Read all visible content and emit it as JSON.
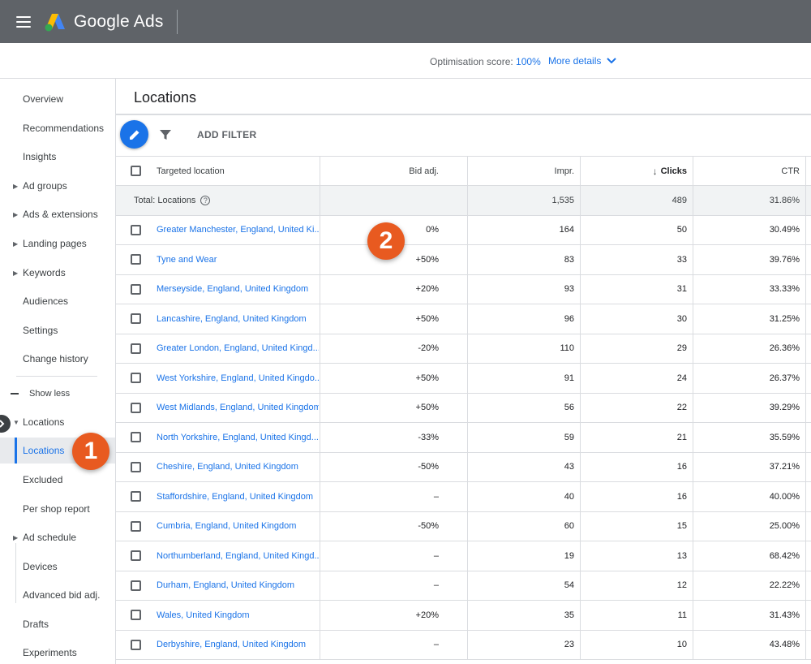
{
  "app": {
    "name": "Google Ads"
  },
  "colors": {
    "topbar": "#5f6368",
    "accent": "#1a73e8",
    "badge": "#e85a20"
  },
  "score": {
    "label": "Optimisation score:",
    "value": "100%",
    "more": "More details"
  },
  "sidebar": {
    "items": [
      {
        "label": "Overview"
      },
      {
        "label": "Recommendations"
      },
      {
        "label": "Insights"
      },
      {
        "label": "Ad groups"
      },
      {
        "label": "Ads & extensions"
      },
      {
        "label": "Landing pages"
      },
      {
        "label": "Keywords"
      },
      {
        "label": "Audiences"
      },
      {
        "label": "Settings"
      },
      {
        "label": "Change history"
      }
    ],
    "show_less": "Show less",
    "locations_group": "Locations",
    "sub_items": [
      {
        "label": "Locations"
      },
      {
        "label": "Excluded"
      },
      {
        "label": "Per shop report"
      }
    ],
    "more_items": [
      {
        "label": "Ad schedule"
      },
      {
        "label": "Devices"
      },
      {
        "label": "Advanced bid adj."
      },
      {
        "label": "Drafts"
      },
      {
        "label": "Experiments"
      }
    ]
  },
  "badges": {
    "one": "1",
    "two": "2"
  },
  "main": {
    "title": "Locations",
    "add_filter": "ADD FILTER",
    "columns": {
      "location": "Targeted location",
      "bid": "Bid adj.",
      "impr": "Impr.",
      "clicks": "Clicks",
      "ctr": "CTR"
    },
    "total": {
      "label": "Total: Locations",
      "impr": "1,535",
      "clicks": "489",
      "ctr": "31.86%"
    },
    "rows": [
      {
        "location": "Greater Manchester, England, United Ki...",
        "bid": "0%",
        "impr": "164",
        "clicks": "50",
        "ctr": "30.49%"
      },
      {
        "location": "Tyne and Wear",
        "bid": "+50%",
        "impr": "83",
        "clicks": "33",
        "ctr": "39.76%"
      },
      {
        "location": "Merseyside, England, United Kingdom",
        "bid": "+20%",
        "impr": "93",
        "clicks": "31",
        "ctr": "33.33%"
      },
      {
        "location": "Lancashire, England, United Kingdom",
        "bid": "+50%",
        "impr": "96",
        "clicks": "30",
        "ctr": "31.25%"
      },
      {
        "location": "Greater London, England, United Kingd...",
        "bid": "-20%",
        "impr": "110",
        "clicks": "29",
        "ctr": "26.36%"
      },
      {
        "location": "West Yorkshire, England, United Kingdo...",
        "bid": "+50%",
        "impr": "91",
        "clicks": "24",
        "ctr": "26.37%"
      },
      {
        "location": "West Midlands, England, United Kingdom",
        "bid": "+50%",
        "impr": "56",
        "clicks": "22",
        "ctr": "39.29%"
      },
      {
        "location": "North Yorkshire, England, United Kingd...",
        "bid": "-33%",
        "impr": "59",
        "clicks": "21",
        "ctr": "35.59%"
      },
      {
        "location": "Cheshire, England, United Kingdom",
        "bid": "-50%",
        "impr": "43",
        "clicks": "16",
        "ctr": "37.21%"
      },
      {
        "location": "Staffordshire, England, United Kingdom",
        "bid": "–",
        "impr": "40",
        "clicks": "16",
        "ctr": "40.00%"
      },
      {
        "location": "Cumbria, England, United Kingdom",
        "bid": "-50%",
        "impr": "60",
        "clicks": "15",
        "ctr": "25.00%"
      },
      {
        "location": "Northumberland, England, United Kingd...",
        "bid": "–",
        "impr": "19",
        "clicks": "13",
        "ctr": "68.42%"
      },
      {
        "location": "Durham, England, United Kingdom",
        "bid": "–",
        "impr": "54",
        "clicks": "12",
        "ctr": "22.22%"
      },
      {
        "location": "Wales, United Kingdom",
        "bid": "+20%",
        "impr": "35",
        "clicks": "11",
        "ctr": "31.43%"
      },
      {
        "location": "Derbyshire, England, United Kingdom",
        "bid": "–",
        "impr": "23",
        "clicks": "10",
        "ctr": "43.48%"
      }
    ]
  }
}
